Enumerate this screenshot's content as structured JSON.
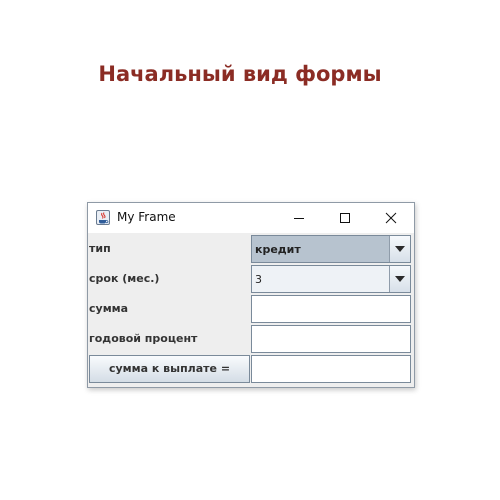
{
  "caption": "Начальный вид формы",
  "window": {
    "title": "My Frame",
    "icon": "java-cup-icon",
    "controls": [
      "minimize-icon",
      "maximize-icon",
      "close-icon"
    ]
  },
  "form": {
    "type": {
      "label": "тип",
      "value": "кредит"
    },
    "term": {
      "label": "срок (мес.)",
      "value": "3"
    },
    "sum": {
      "label": "сумма",
      "value": ""
    },
    "rate": {
      "label": "годовой процент",
      "value": ""
    },
    "payment": {
      "button_label": "сумма к выплате =",
      "value": ""
    }
  },
  "colors": {
    "caption": "#8b2c24",
    "selected_combo": "#b7c3cf"
  }
}
